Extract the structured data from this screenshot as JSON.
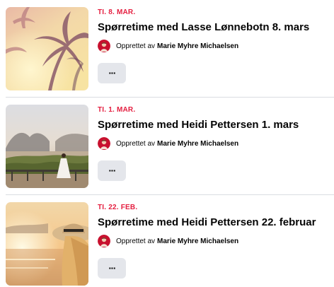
{
  "events": [
    {
      "date": "TI. 8. MAR.",
      "title": "Spørretime med Lasse Lønnebotn 8. mars",
      "created_by_prefix": "Opprettet av",
      "creator": "Marie Myhre Michaelsen",
      "more_label": "···",
      "image": "palm-sunset-photo"
    },
    {
      "date": "TI. 1. MAR.",
      "title": "Spørretime med Heidi Pettersen 1. mars",
      "created_by_prefix": "Opprettet av",
      "creator": "Marie Myhre Michaelsen",
      "more_label": "···",
      "image": "woman-on-terrace-photo"
    },
    {
      "date": "TI. 22. FEB.",
      "title": "Spørretime med Heidi Pettersen 22. februar",
      "created_by_prefix": "Opprettet av",
      "creator": "Marie Myhre Michaelsen",
      "more_label": "···",
      "image": "woman-with-hat-beach-photo"
    }
  ],
  "colors": {
    "date": "#e41e3f",
    "button_bg": "#e4e6eb",
    "divider": "#dadde1"
  }
}
